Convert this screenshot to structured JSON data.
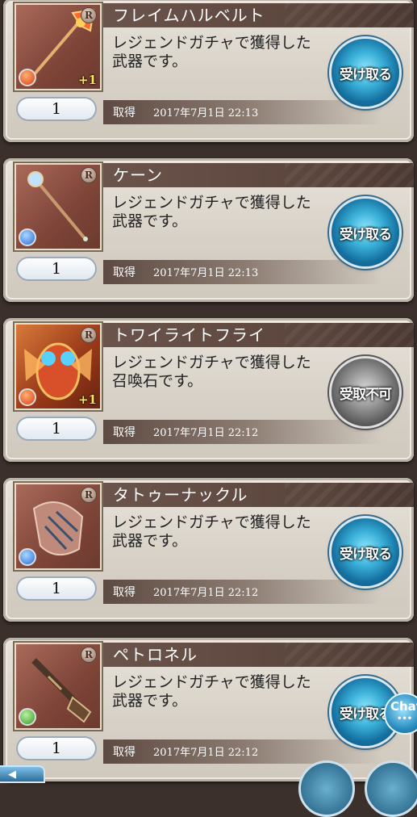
{
  "items": [
    {
      "name": "フレイムハルベルト",
      "desc": "レジェンドガチャで獲得した武器です。",
      "qty": "1",
      "acquired_label": "取得",
      "date": "2017年7月1日 22:13",
      "button": "受け取る",
      "enabled": true,
      "rarity": "R",
      "plus": "+1",
      "element": "fire",
      "icon": "halberd-icon"
    },
    {
      "name": "ケーン",
      "desc": "レジェンドガチャで獲得した武器です。",
      "qty": "1",
      "acquired_label": "取得",
      "date": "2017年7月1日 22:13",
      "button": "受け取る",
      "enabled": true,
      "rarity": "R",
      "plus": "",
      "element": "water",
      "icon": "cane-icon"
    },
    {
      "name": "トワイライトフライ",
      "desc": "レジェンドガチャで獲得した召喚石です。",
      "qty": "1",
      "acquired_label": "取得",
      "date": "2017年7月1日 22:12",
      "button": "受取不可",
      "enabled": false,
      "rarity": "R",
      "plus": "+1",
      "element": "fire",
      "icon": "summon-fly-icon"
    },
    {
      "name": "タトゥーナックル",
      "desc": "レジェンドガチャで獲得した武器です。",
      "qty": "1",
      "acquired_label": "取得",
      "date": "2017年7月1日 22:12",
      "button": "受け取る",
      "enabled": true,
      "rarity": "R",
      "plus": "",
      "element": "water",
      "icon": "knuckle-icon"
    },
    {
      "name": "ペトロネル",
      "desc": "レジェンドガチャで獲得した武器です。",
      "qty": "1",
      "acquired_label": "取得",
      "date": "2017年7月1日 22:12",
      "button": "受け取る",
      "enabled": true,
      "rarity": "R",
      "plus": "",
      "element": "wind",
      "icon": "gun-icon"
    }
  ],
  "chat": {
    "label": "Chat"
  },
  "nav": {
    "back_label": "◀"
  }
}
